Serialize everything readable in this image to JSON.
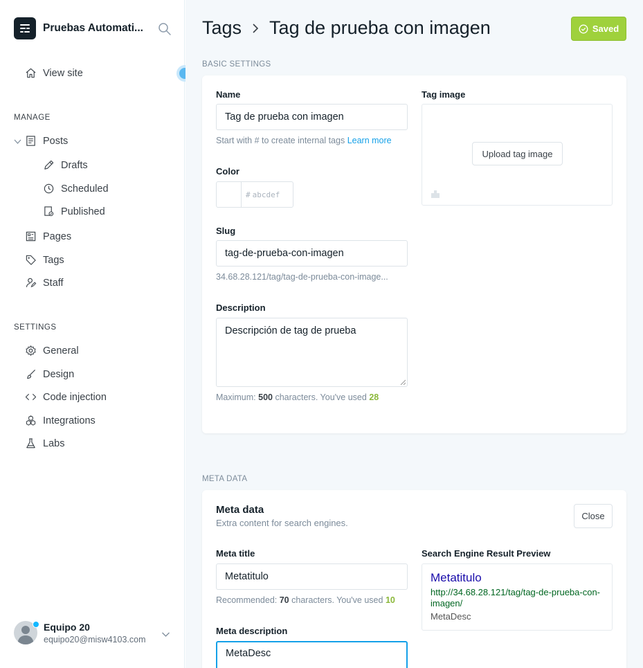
{
  "sidebar": {
    "brand": "Pruebas Automati...",
    "view_site": "View site",
    "manage_label": "MANAGE",
    "posts": "Posts",
    "drafts": "Drafts",
    "scheduled": "Scheduled",
    "published": "Published",
    "pages": "Pages",
    "tags": "Tags",
    "staff": "Staff",
    "settings_label": "SETTINGS",
    "general": "General",
    "design": "Design",
    "code_injection": "Code injection",
    "integrations": "Integrations",
    "labs": "Labs",
    "user_name": "Equipo 20",
    "user_email": "equipo20@misw4103.com"
  },
  "header": {
    "crumb": "Tags",
    "title": "Tag de prueba con imagen",
    "saved_label": "Saved"
  },
  "basic": {
    "section": "BASIC SETTINGS",
    "name_label": "Name",
    "name_value": "Tag de prueba con imagen",
    "name_help": "Start with # to create internal tags",
    "learn_more": "Learn more",
    "color_label": "Color",
    "color_hash": "#",
    "color_placeholder": "abcdef",
    "slug_label": "Slug",
    "slug_value": "tag-de-prueba-con-imagen",
    "slug_url": "34.68.28.121/tag/tag-de-prueba-con-image...",
    "desc_label": "Description",
    "desc_value": "Descripción de tag de prueba",
    "desc_help_prefix": "Maximum:",
    "desc_max": "500",
    "desc_help_mid": "characters. You've used",
    "desc_used": "28",
    "image_label": "Tag image",
    "upload_label": "Upload tag image"
  },
  "meta": {
    "section": "META DATA",
    "card_title": "Meta data",
    "card_sub": "Extra content for search engines.",
    "close_label": "Close",
    "title_label": "Meta title",
    "title_value": "Metatitulo",
    "title_help_prefix": "Recommended:",
    "title_rec": "70",
    "title_help_mid": "characters. You've used",
    "title_used": "10",
    "desc_label": "Meta description",
    "desc_value": "MetaDesc",
    "serp_label": "Search Engine Result Preview",
    "serp_title": "Metatitulo",
    "serp_url": "http://34.68.28.121/tag/tag-de-prueba-con-imagen/",
    "serp_desc": "MetaDesc"
  },
  "colors": {
    "accent_green": "#9fd13c",
    "link_blue": "#14a0e8"
  }
}
